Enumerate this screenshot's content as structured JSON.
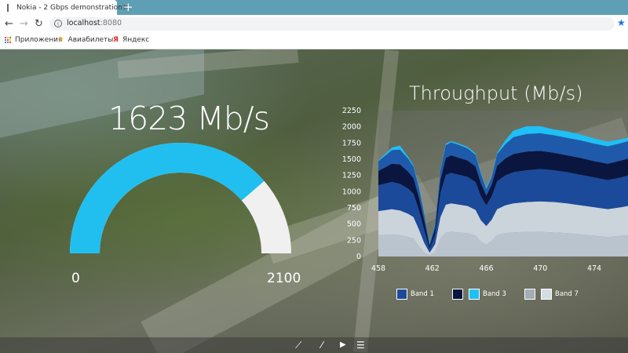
{
  "browser": {
    "tab_title": "Nokia - 2 Gbps demonstration",
    "tab_close": "✕",
    "new_tab": "+",
    "url_host": "localhost",
    "url_port": ":8080",
    "back": "←",
    "forward": "→",
    "reload": "↻",
    "star": "★",
    "bookmarks": [
      {
        "label": "Приложения",
        "icon": "apps-grid-icon"
      },
      {
        "label": "Авиабилеты",
        "icon": "airplane-icon",
        "glyph": "✈"
      },
      {
        "label": "Яндекс",
        "icon": "yandex-icon",
        "glyph": "Я"
      }
    ]
  },
  "gauge": {
    "readout": "1623 Mb/s",
    "min_label": "0",
    "max_label": "2100",
    "value": 1623,
    "min": 0,
    "max": 2100,
    "fill_color": "#20bff0",
    "track_color": "#f0f0f0"
  },
  "chart_data": {
    "type": "area",
    "title": "Throughput (Mb/s)",
    "xlabel": "",
    "ylabel": "",
    "ylim": [
      0,
      2250
    ],
    "xlim": [
      458,
      476.5
    ],
    "yticks": [
      0,
      250,
      500,
      750,
      1000,
      1250,
      1500,
      1750,
      2000,
      2250
    ],
    "xticks": [
      458,
      462,
      466,
      470,
      474
    ],
    "x": [
      458,
      459,
      459.6,
      460.2,
      460.6,
      461,
      461.4,
      461.8,
      462.2,
      462.6,
      463,
      463.4,
      464,
      464.6,
      465.2,
      465.6,
      466,
      466.4,
      466.8,
      467.4,
      468,
      469,
      470,
      471,
      472,
      473,
      474,
      475,
      476,
      476.5
    ],
    "series": [
      {
        "name": "",
        "color": "#b9c4cf",
        "values": [
          330,
          340,
          330,
          300,
          280,
          160,
          60,
          20,
          70,
          280,
          370,
          380,
          370,
          360,
          320,
          230,
          180,
          240,
          330,
          360,
          370,
          380,
          380,
          370,
          360,
          340,
          320,
          300,
          320,
          330
        ]
      },
      {
        "name": "",
        "color": "#cbd3db",
        "values": [
          370,
          390,
          380,
          360,
          330,
          260,
          150,
          40,
          120,
          330,
          430,
          440,
          430,
          420,
          400,
          330,
          290,
          330,
          400,
          430,
          450,
          460,
          470,
          470,
          460,
          450,
          440,
          430,
          440,
          450
        ]
      },
      {
        "name": "Band 1",
        "color": "#1c4a9a",
        "values": [
          400,
          420,
          410,
          390,
          360,
          300,
          200,
          60,
          150,
          370,
          460,
          470,
          460,
          450,
          430,
          370,
          320,
          360,
          430,
          460,
          480,
          490,
          500,
          490,
          480,
          470,
          460,
          450,
          460,
          470
        ]
      },
      {
        "name": "",
        "color": "#0a1640",
        "values": [
          220,
          280,
          300,
          260,
          240,
          200,
          140,
          40,
          90,
          200,
          260,
          270,
          260,
          250,
          240,
          200,
          150,
          180,
          240,
          260,
          280,
          290,
          280,
          270,
          260,
          260,
          250,
          250,
          260,
          260
        ]
      },
      {
        "name": "",
        "color": "#1f5aaa",
        "values": [
          150,
          210,
          230,
          200,
          180,
          150,
          100,
          30,
          60,
          150,
          200,
          200,
          200,
          190,
          180,
          150,
          100,
          120,
          180,
          220,
          260,
          270,
          270,
          270,
          270,
          270,
          270,
          270,
          270,
          270
        ]
      },
      {
        "name": "Band 3",
        "color": "#1ec0f5",
        "values": [
          10,
          40,
          60,
          30,
          20,
          20,
          20,
          20,
          20,
          20,
          20,
          20,
          20,
          20,
          20,
          20,
          20,
          20,
          20,
          60,
          100,
          120,
          110,
          90,
          100,
          90,
          80,
          70,
          60,
          50
        ]
      },
      {
        "name": "Band 7",
        "color": "#d5dce3",
        "values": [
          0,
          0,
          0,
          0,
          0,
          0,
          0,
          0,
          0,
          0,
          0,
          0,
          0,
          0,
          0,
          0,
          0,
          0,
          0,
          0,
          0,
          0,
          0,
          0,
          0,
          0,
          0,
          0,
          0,
          0
        ]
      }
    ],
    "legend": [
      {
        "label": "Band 1",
        "colors": [
          "#1c4a9a"
        ]
      },
      {
        "label": "Band 3",
        "colors": [
          "#0a1640",
          "#1ec0f5"
        ]
      },
      {
        "label": "Band 7",
        "colors": [
          "#a4acb4",
          "#d5dce3"
        ]
      }
    ],
    "plot_bg": "#6f7373",
    "grid": false,
    "legend_position": "bottom"
  },
  "controls": [
    {
      "name": "chart-mode-icon",
      "glyph": "⟋"
    },
    {
      "name": "pause-icon",
      "glyph": "⁄"
    },
    {
      "name": "play-icon",
      "glyph": "▶"
    },
    {
      "name": "list-icon",
      "glyph": "☰"
    }
  ]
}
